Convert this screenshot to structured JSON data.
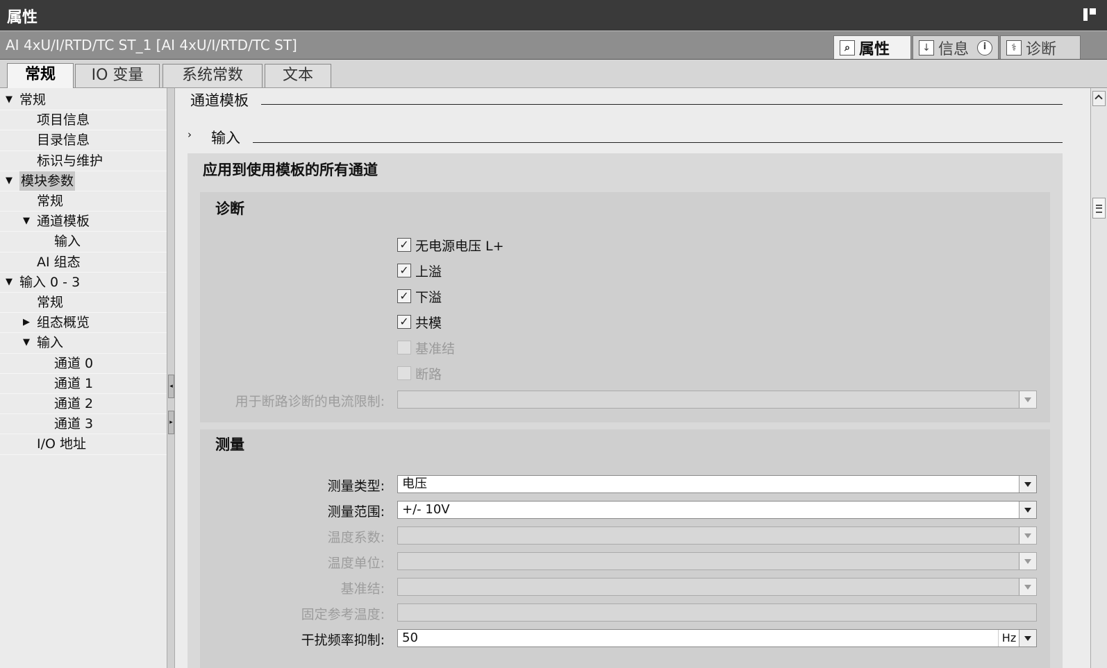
{
  "window": {
    "title": "属性"
  },
  "object_bar": {
    "object_name": "AI 4xU/I/RTD/TC ST_1 [AI 4xU/I/RTD/TC ST]",
    "tabs": [
      {
        "label": "属性",
        "icon": "magnifier-properties-icon",
        "active": true
      },
      {
        "label": "信息",
        "icon": "info-icon",
        "active": false
      },
      {
        "label": "诊断",
        "icon": "diagnostics-icon",
        "active": false
      }
    ],
    "info_badge": "i"
  },
  "main_tabs": [
    {
      "label": "常规",
      "active": true
    },
    {
      "label": "IO 变量",
      "active": false
    },
    {
      "label": "系统常数",
      "active": false
    },
    {
      "label": "文本",
      "active": false
    }
  ],
  "tree": [
    {
      "label": "常规",
      "level": 0,
      "state": "expanded"
    },
    {
      "label": "项目信息",
      "level": 1
    },
    {
      "label": "目录信息",
      "level": 1
    },
    {
      "label": "标识与维护",
      "level": 1
    },
    {
      "label": "模块参数",
      "level": 0,
      "state": "expanded",
      "selected": true
    },
    {
      "label": "常规",
      "level": 1
    },
    {
      "label": "通道模板",
      "level": 1,
      "state": "expanded"
    },
    {
      "label": "输入",
      "level": 2
    },
    {
      "label": "AI 组态",
      "level": 1
    },
    {
      "label": "输入 0 - 3",
      "level": 0,
      "state": "expanded"
    },
    {
      "label": "常规",
      "level": 1
    },
    {
      "label": "组态概览",
      "level": 1,
      "state": "collapsed"
    },
    {
      "label": "输入",
      "level": 1,
      "state": "expanded"
    },
    {
      "label": "通道 0",
      "level": 2
    },
    {
      "label": "通道 1",
      "level": 2
    },
    {
      "label": "通道 2",
      "level": 2
    },
    {
      "label": "通道 3",
      "level": 2
    },
    {
      "label": "I/O 地址",
      "level": 1
    }
  ],
  "content": {
    "section_title": "通道模板",
    "subsection_title": "输入",
    "panel_title": "应用到使用模板的所有通道",
    "diagnostics": {
      "title": "诊断",
      "checkboxes": [
        {
          "label": "无电源电压 L+",
          "checked": true,
          "enabled": true
        },
        {
          "label": "上溢",
          "checked": true,
          "enabled": true
        },
        {
          "label": "下溢",
          "checked": true,
          "enabled": true
        },
        {
          "label": "共模",
          "checked": true,
          "enabled": true
        },
        {
          "label": "基准结",
          "checked": false,
          "enabled": false
        },
        {
          "label": "断路",
          "checked": false,
          "enabled": false
        }
      ],
      "current_limit_label": "用于断路诊断的电流限制:",
      "current_limit_value": ""
    },
    "measurement": {
      "title": "测量",
      "fields": [
        {
          "label": "测量类型:",
          "value": "电压",
          "enabled": true,
          "dropdown": true
        },
        {
          "label": "测量范围:",
          "value": "+/- 10V",
          "enabled": true,
          "dropdown": true
        },
        {
          "label": "温度系数:",
          "value": "",
          "enabled": false,
          "dropdown": true
        },
        {
          "label": "温度单位:",
          "value": "",
          "enabled": false,
          "dropdown": true
        },
        {
          "label": "基准结:",
          "value": "",
          "enabled": false,
          "dropdown": true
        },
        {
          "label": "固定参考温度:",
          "value": "",
          "enabled": false,
          "dropdown": false
        },
        {
          "label": "干扰频率抑制:",
          "value": "50",
          "unit": "Hz",
          "enabled": true,
          "dropdown": true
        }
      ]
    }
  }
}
